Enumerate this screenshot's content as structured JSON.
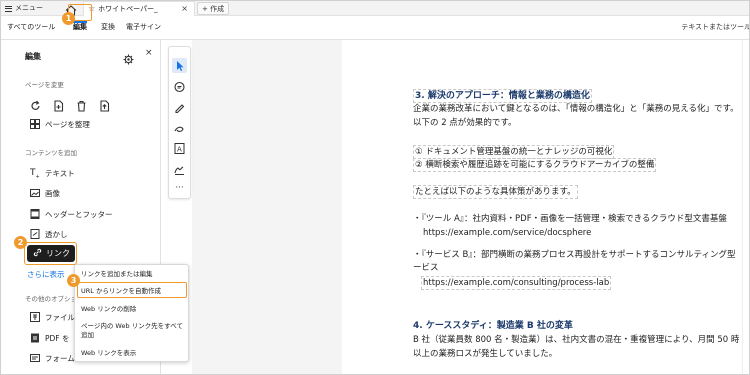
{
  "tabbar": {
    "menu_label": "メニュー",
    "tab_title": "ホワイトペーパー_",
    "tab_close": "×",
    "new_tab_label": "+ 作成"
  },
  "menubar": {
    "items": [
      "すべてのツール",
      "編集",
      "変換",
      "電子サイン"
    ],
    "search_placeholder": "テキストまたはツール"
  },
  "callouts": [
    "1",
    "2",
    "3"
  ],
  "panel": {
    "title": "編集",
    "close": "×",
    "section_page": "ページを変更",
    "organize_pages": "ページを整理",
    "section_content": "コンテンツを追加",
    "items": [
      "テキスト",
      "画像",
      "ヘッダーとフッター",
      "透かし"
    ],
    "link_button": "リンク",
    "show_more": "さらに表示",
    "section_other": "その他のオプショ",
    "other_items": [
      "ファイル",
      "PDF を",
      "フォーム"
    ]
  },
  "link_menu": {
    "items": [
      "リンクを追加または編集",
      "URL からリンクを自動作成",
      "Web リンクの削除",
      "ページ内の Web リンク先をすべて",
      "追加",
      "Web リンクを表示"
    ]
  },
  "document": {
    "heading3": "3. 解決のアプローチ：情報と業務の構造化",
    "para1_l1": "企業の業務改革において鍵となるのは、「情報の構造化」と「業務の見える化」です。",
    "para1_l2": "以下の 2 点が効果的です。",
    "list1": "① ドキュメント管理基盤の統一とナレッジの可視化",
    "list2": "② 横断検索や履歴追跡を可能にするクラウドアーカイブの整備",
    "example_intro": "たとえば以下のような具体策があります。",
    "tool_a": "・『ツール A』：社内資料・PDF・画像を一括管理・検索できるクラウド型文書基盤",
    "url_a": "https://example.com/service/docsphere",
    "service_b_l1": "・『サービス B』：部門横断の業務プロセス再設計をサポートするコンサルティング型",
    "service_b_l2": "ービス",
    "url_b": "https://example.com/consulting/process-lab",
    "heading4": "4. ケーススタディ：製造業 B 社の変革",
    "para4_l1": "B 社（従業員数 800 名・製造業）は、社内文書の混在・重複管理により、月間 50 時",
    "para4_l2": "以上の業務ロスが発生していました。"
  },
  "colors": {
    "accent_orange": "#f09a2e",
    "link_blue": "#1473e6",
    "heading_navy": "#1b3a6b"
  }
}
